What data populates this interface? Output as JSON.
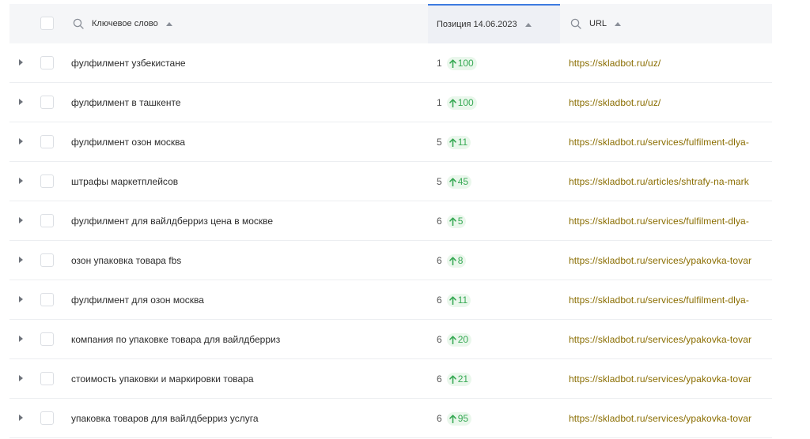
{
  "header": {
    "keyword_label": "Ключевое слово",
    "position_label": "Позиция 14.06.2023",
    "url_label": "URL"
  },
  "colors": {
    "accent": "#3d7be0",
    "badge_text": "#37a954",
    "badge_bg": "#eaf7ec",
    "url_text": "#8a6d00"
  },
  "rows": [
    {
      "keyword": "фулфилмент узбекистане",
      "position": "1",
      "change": "100",
      "url": "https://skladbot.ru/uz/"
    },
    {
      "keyword": "фулфилмент в ташкенте",
      "position": "1",
      "change": "100",
      "url": "https://skladbot.ru/uz/"
    },
    {
      "keyword": "фулфилмент озон москва",
      "position": "5",
      "change": "11",
      "url": "https://skladbot.ru/services/fulfilment-dlya-"
    },
    {
      "keyword": "штрафы маркетплейсов",
      "position": "5",
      "change": "45",
      "url": "https://skladbot.ru/articles/shtrafy-na-mark"
    },
    {
      "keyword": "фулфилмент для вайлдберриз цена в москве",
      "position": "6",
      "change": "5",
      "url": "https://skladbot.ru/services/fulfilment-dlya-"
    },
    {
      "keyword": "озон упаковка товара fbs",
      "position": "6",
      "change": "8",
      "url": "https://skladbot.ru/services/ypakovka-tovar"
    },
    {
      "keyword": "фулфилмент для озон москва",
      "position": "6",
      "change": "11",
      "url": "https://skladbot.ru/services/fulfilment-dlya-"
    },
    {
      "keyword": "компания по упаковке товара для вайлдберриз",
      "position": "6",
      "change": "20",
      "url": "https://skladbot.ru/services/ypakovka-tovar"
    },
    {
      "keyword": "стоимость упаковки и маркировки товара",
      "position": "6",
      "change": "21",
      "url": "https://skladbot.ru/services/ypakovka-tovar"
    },
    {
      "keyword": "упаковка товаров для вайлдберриз услуга",
      "position": "6",
      "change": "95",
      "url": "https://skladbot.ru/services/ypakovka-tovar"
    }
  ]
}
